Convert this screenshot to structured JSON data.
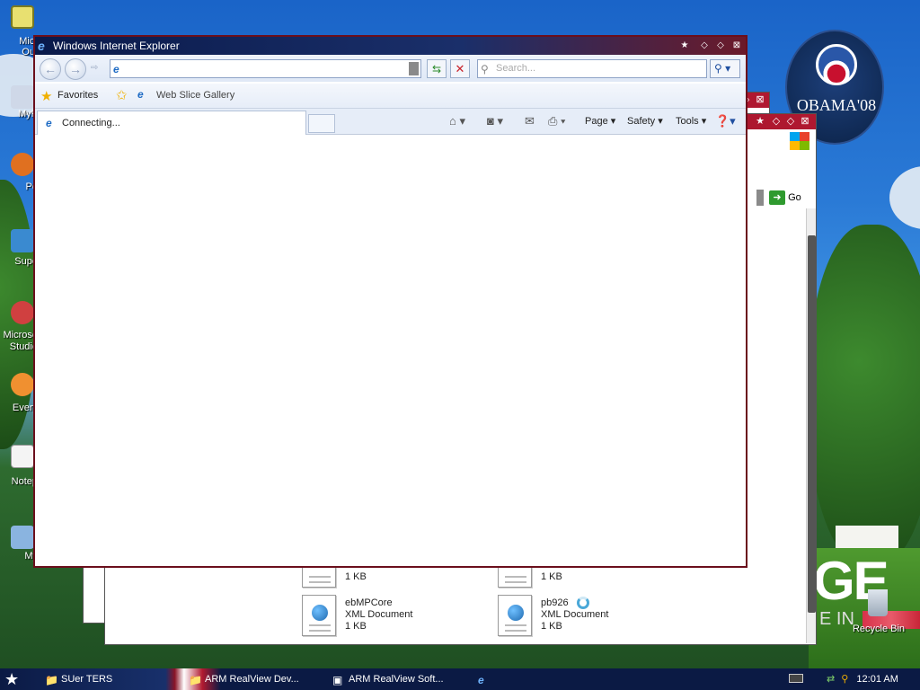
{
  "desktop": {
    "left_icons": [
      {
        "label": "Micr\nOut",
        "name": "desktop-icon-outlook"
      },
      {
        "label": "MyP",
        "name": "desktop-icon-mypc"
      },
      {
        "label": "Pe",
        "name": "desktop-icon-pe"
      },
      {
        "label": "Supe",
        "name": "desktop-icon-super"
      },
      {
        "label": "Microso\nStudio",
        "name": "desktop-icon-microsoft-studio"
      },
      {
        "label": "Every",
        "name": "desktop-icon-every"
      },
      {
        "label": "Notep",
        "name": "desktop-icon-notepad"
      },
      {
        "label": "My",
        "name": "desktop-icon-my"
      }
    ],
    "recycle_bin": "Recycle Bin",
    "badge_text": "OBAMA'08",
    "big_text": "GE",
    "big_text2": "E IN"
  },
  "ie": {
    "title": "Windows Internet Explorer",
    "address_value": "",
    "search_placeholder": "Search...",
    "favorites_label": "Favorites",
    "web_slice_label": "Web Slice Gallery",
    "tab_label": "Connecting...",
    "command_bar": {
      "page": "Page",
      "safety": "Safety",
      "tools": "Tools"
    }
  },
  "background_window": {
    "go_label": "Go",
    "files": [
      {
        "name": "",
        "type": "",
        "size": "1 KB"
      },
      {
        "name": "",
        "type": "",
        "size": "1 KB"
      },
      {
        "name": "ebMPCore",
        "type": "XML Document",
        "size": "1 KB"
      },
      {
        "name": "pb926",
        "type": "XML Document",
        "size": "1 KB"
      }
    ]
  },
  "taskbar": {
    "items": [
      {
        "label": "SUer TERS",
        "icon": "folder-icon"
      },
      {
        "label": "ARM RealView Dev...",
        "icon": "folder-icon"
      },
      {
        "label": "ARM RealView Soft...",
        "icon": "installer-icon"
      }
    ],
    "clock": "12:01 AM"
  }
}
